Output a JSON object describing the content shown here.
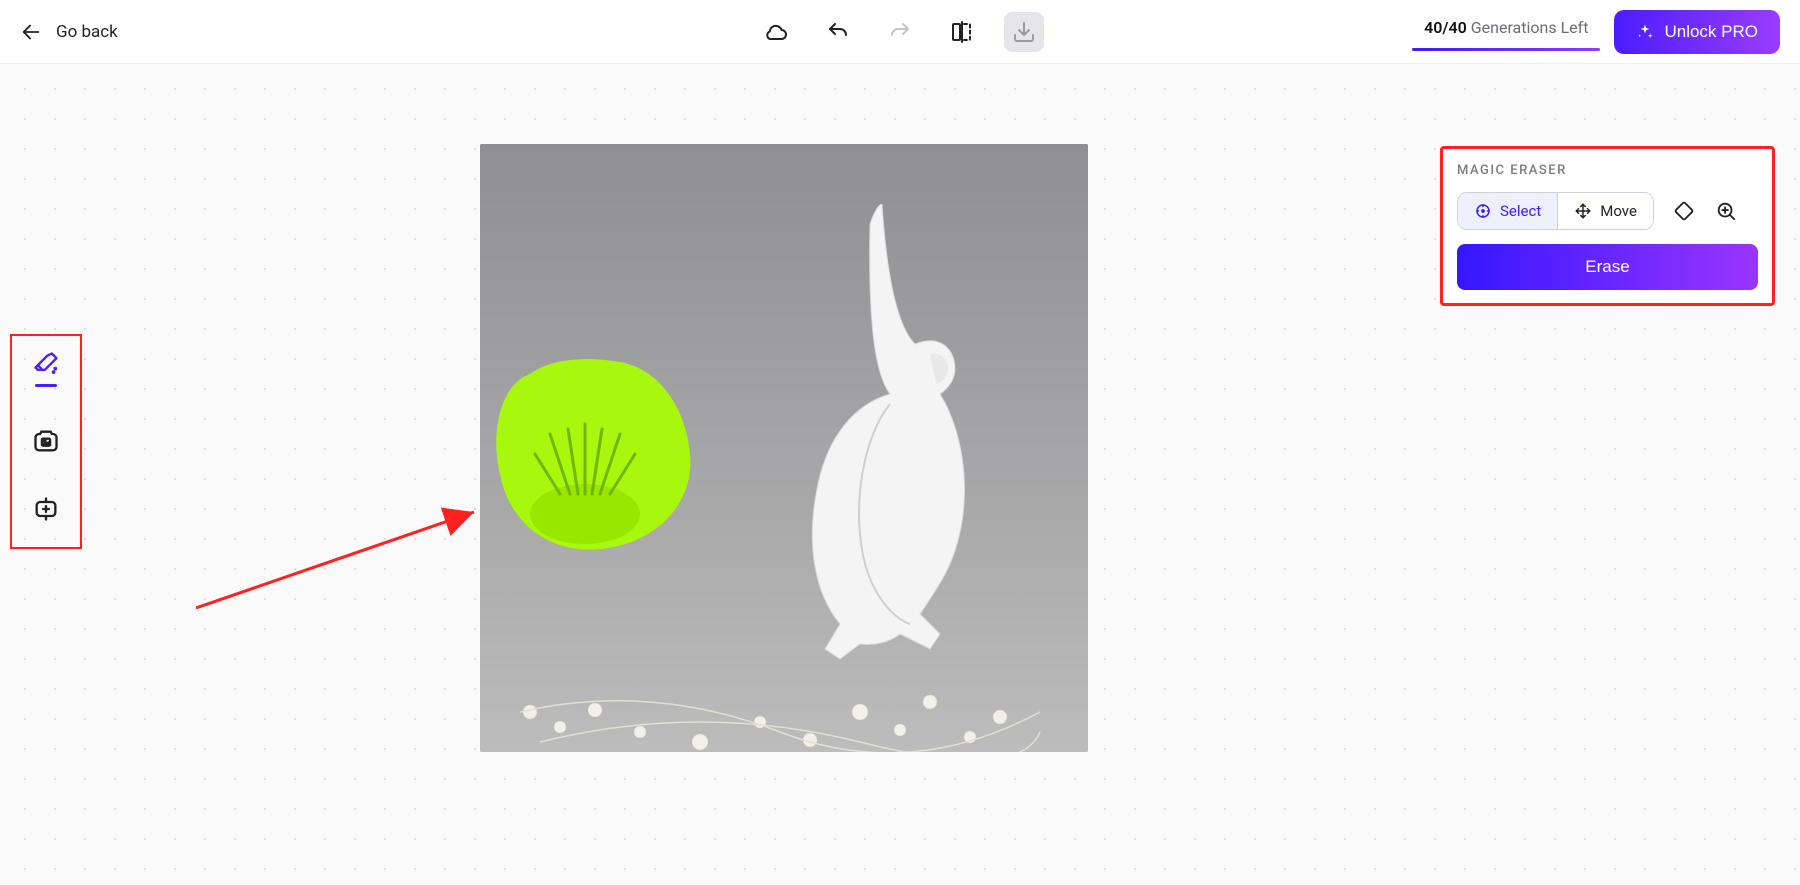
{
  "header": {
    "go_back_label": "Go back",
    "generations": {
      "used": "40",
      "total": "40",
      "suffix": "Generations Left"
    },
    "unlock_label": "Unlock PRO"
  },
  "left_tools": [
    {
      "name": "magic-eraser-tool",
      "active": true
    },
    {
      "name": "replace-tool",
      "active": false
    },
    {
      "name": "expand-tool",
      "active": false
    }
  ],
  "panel": {
    "title": "MAGIC ERASER",
    "select_label": "Select",
    "move_label": "Move",
    "erase_label": "Erase"
  }
}
